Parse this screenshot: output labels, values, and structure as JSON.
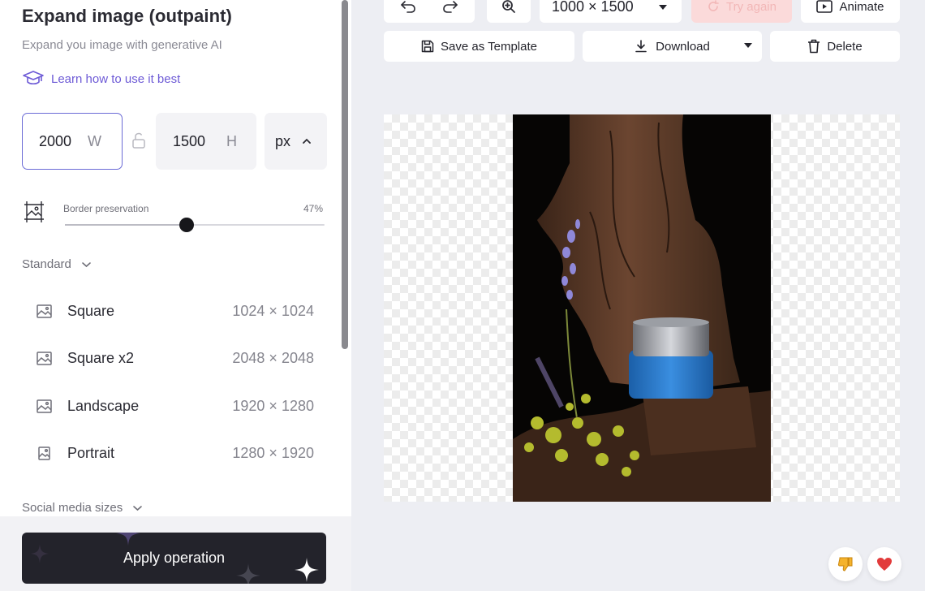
{
  "panel": {
    "title": "Expand image (outpaint)",
    "subtitle": "Expand you image with generative AI",
    "learn_link": "Learn how to use it best",
    "width_value": "2000",
    "width_label": "W",
    "height_value": "1500",
    "height_label": "H",
    "unit": "px",
    "border_preservation_label": "Border preservation",
    "border_preservation_value": "47%",
    "border_preservation_level": 0.47,
    "standard_section": "Standard",
    "social_section": "Social media sizes",
    "sizes": [
      {
        "name": "Square",
        "dims": "1024 × 1024"
      },
      {
        "name": "Square x2",
        "dims": "2048 × 2048"
      },
      {
        "name": "Landscape",
        "dims": "1920 × 1280"
      },
      {
        "name": "Portrait",
        "dims": "1280 × 1920"
      }
    ],
    "apply_label": "Apply operation"
  },
  "toolbar": {
    "resolution": "1000 × 1500",
    "try_again": "Try again",
    "animate": "Animate",
    "save_template": "Save as Template",
    "download": "Download",
    "delete": "Delete"
  },
  "colors": {
    "accent": "#6d5ad6",
    "apply_bg": "#23232b",
    "try_again_bg": "#fbdada"
  },
  "icons": [
    "undo-icon",
    "redo-icon",
    "zoom-in-icon",
    "caret-down-icon",
    "refresh-icon",
    "play-icon",
    "save-icon",
    "download-icon",
    "trash-icon",
    "graduation-cap-icon",
    "lock-icon",
    "image-icon",
    "chevron-down-icon",
    "chevron-up-icon",
    "thumbs-down-icon",
    "heart-icon",
    "sparkle-icon"
  ]
}
